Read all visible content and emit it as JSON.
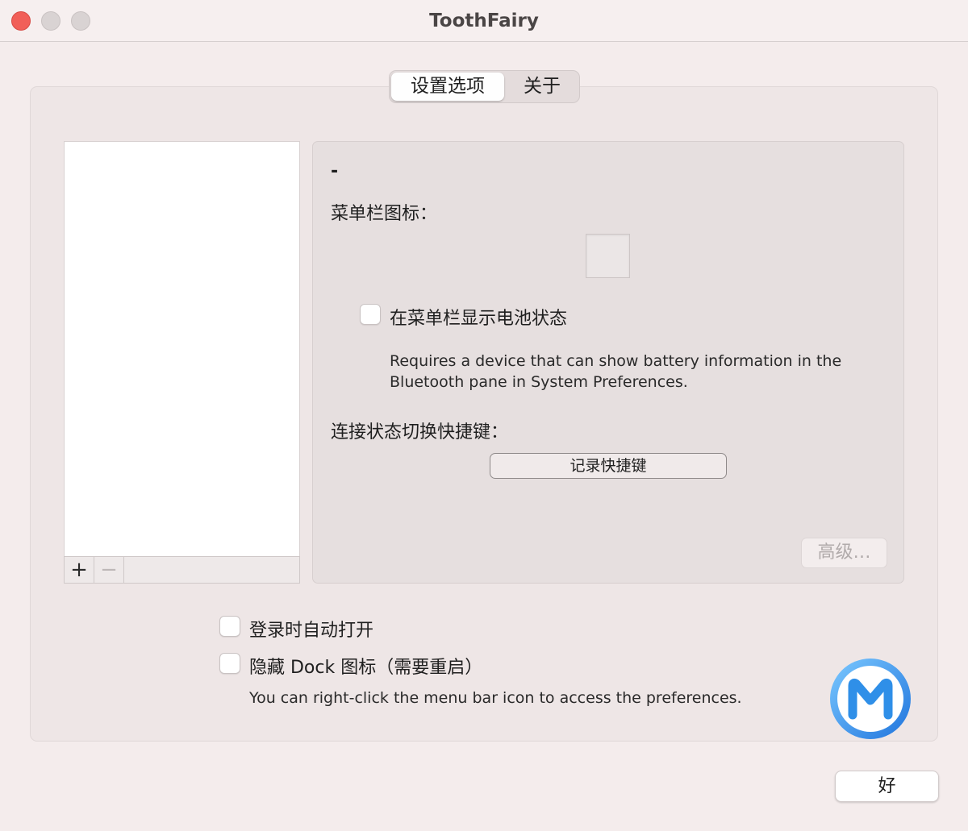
{
  "window": {
    "title": "ToothFairy"
  },
  "tabs": [
    {
      "label": "设置选项",
      "selected": true
    },
    {
      "label": "关于",
      "selected": false
    }
  ],
  "device_list": {
    "items": [],
    "add_label": "+",
    "remove_label": "−"
  },
  "device": {
    "name": "-",
    "menu_icon_label": "菜单栏图标：",
    "show_battery_label": "在菜单栏显示电池状态",
    "show_battery_checked": false,
    "battery_help_line1": "Requires a device that can show battery information in the",
    "battery_help_line2": "Bluetooth pane in System Preferences.",
    "shortcut_label": "连接状态切换快捷键：",
    "record_shortcut_label": "记录快捷键",
    "advanced_label": "高级…"
  },
  "options": {
    "launch_at_login_label": "登录时自动打开",
    "launch_at_login_checked": false,
    "hide_dock_label": "隐藏 Dock 图标（需要重启）",
    "hide_dock_checked": false,
    "hint": "You can right-click the menu bar icon to access the preferences."
  },
  "ok_label": "好",
  "colors": {
    "close": "#f15f58",
    "logo_blue": "#2f8fe8"
  }
}
